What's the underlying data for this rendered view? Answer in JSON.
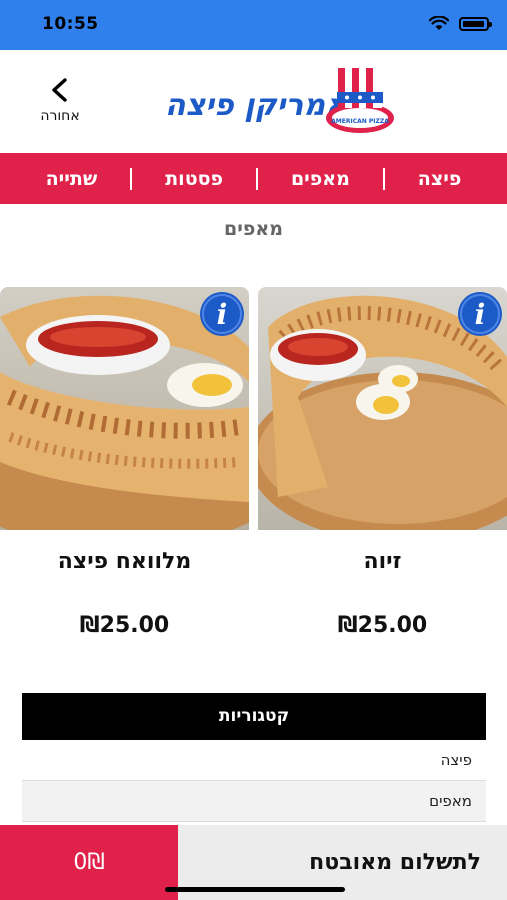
{
  "status_bar": {
    "time": "10:55"
  },
  "header": {
    "logo_text": "אמריקן פיצה",
    "logo_badge_text": "AMERICAN PIZZA",
    "back_label": "אחורה"
  },
  "nav": {
    "items": [
      {
        "label": "פיצה"
      },
      {
        "label": "מאפים"
      },
      {
        "label": "פסטות"
      },
      {
        "label": "שתייה"
      }
    ]
  },
  "section_title": "מאפים",
  "products": [
    {
      "name": "זיוה",
      "price": "₪25.00"
    },
    {
      "name": "מלוואח פיצה",
      "price": "₪25.00"
    }
  ],
  "categories": {
    "title": "קטגוריות",
    "items": [
      {
        "label": "פיצה"
      },
      {
        "label": "מאפים"
      }
    ]
  },
  "bottom_bar": {
    "cart_total": "0₪",
    "checkout_label": "לתשלום מאובטח"
  },
  "colors": {
    "brand_red": "#e0224b",
    "status_blue": "#2f80ed",
    "logo_blue": "#1c5ac7"
  }
}
